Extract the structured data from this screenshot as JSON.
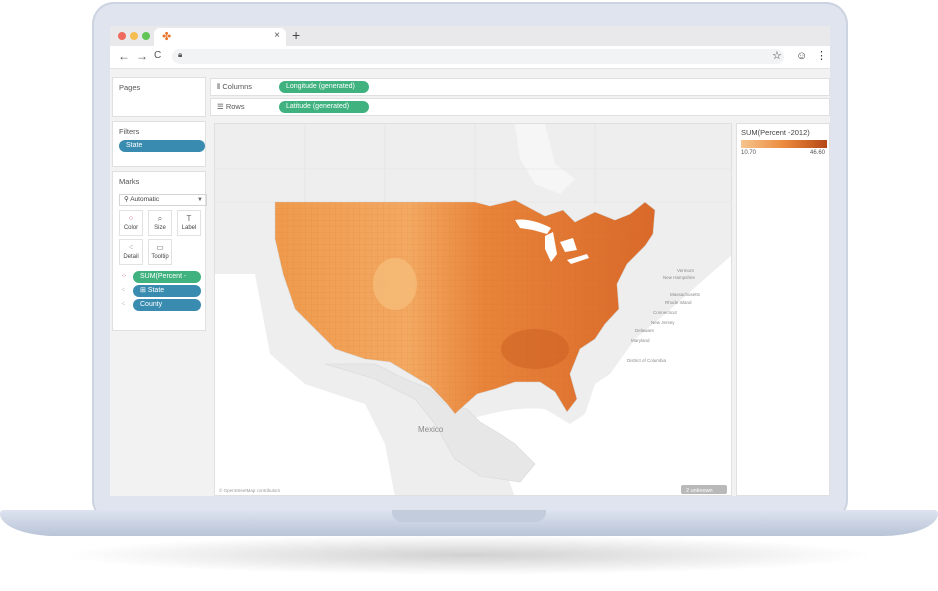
{
  "browser": {
    "window_dots": [
      "#ee6a5e",
      "#f5bd4f",
      "#61c454"
    ],
    "tab": {
      "close": "×"
    },
    "new_tab": "+",
    "nav": {
      "back": "←",
      "forward": "→",
      "reload": "C"
    }
  },
  "tableau": {
    "pages": {
      "title": "Pages"
    },
    "filters": {
      "title": "Filters",
      "pills": [
        "State"
      ]
    },
    "marks": {
      "title": "Marks",
      "mark_type": "Automatic",
      "buttons": [
        {
          "label": "Color",
          "icon": "color-dots-icon"
        },
        {
          "label": "Size",
          "icon": "size-icon"
        },
        {
          "label": "Label",
          "icon": "label-icon"
        },
        {
          "label": "Detail",
          "icon": "detail-icon"
        },
        {
          "label": "Tooltip",
          "icon": "tooltip-icon"
        }
      ],
      "fields": [
        "SUM(Percent -",
        "State",
        "County"
      ]
    },
    "shelves": {
      "columns": {
        "label": "Columns",
        "pill": "Longitude (generated)"
      },
      "rows": {
        "label": "Rows",
        "pill": "Latitude (generated)"
      }
    },
    "map": {
      "country_label": "Mexico",
      "attribution": "© OpenStreetMap contributors",
      "unknown_badge": "2 unknown",
      "place_labels": [
        "Vermont",
        "New Hampshire",
        "Massachusetts",
        "Rhode Island",
        "Connecticut",
        "New Jersey",
        "Delaware",
        "Maryland",
        "District of Columbia"
      ]
    },
    "legend": {
      "title": "SUM(Percent -2012)",
      "min": "10.70",
      "max": "46.60",
      "color_low": "#f6c48e",
      "color_high": "#b54716"
    }
  }
}
